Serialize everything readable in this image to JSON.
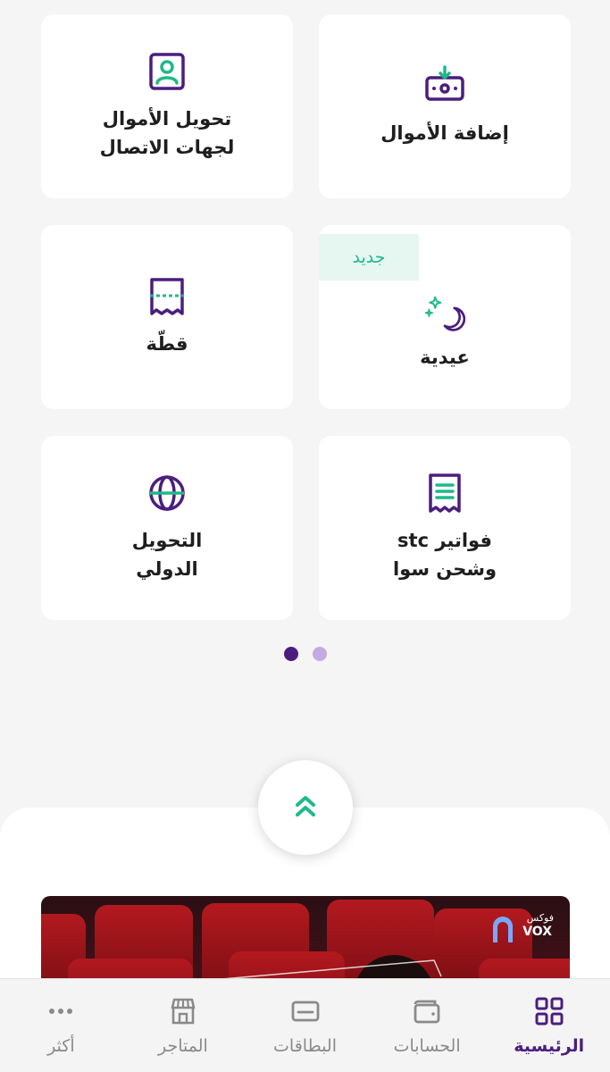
{
  "tiles": [
    {
      "label": "إضافة الأموال",
      "icon": "add-money-icon"
    },
    {
      "label": "تحويل الأموال\nلجهات الاتصال",
      "icon": "contact-transfer-icon"
    },
    {
      "label": "عيدية",
      "icon": "crescent-moon-icon",
      "badge": "جديد"
    },
    {
      "label": "قطّة",
      "icon": "split-bill-icon"
    },
    {
      "label": "فواتير stc\nوشحن سوا",
      "icon": "bill-receipt-icon"
    },
    {
      "label": "التحويل\nالدولي",
      "icon": "globe-icon"
    }
  ],
  "pager": {
    "total": 2,
    "active": 1
  },
  "banner": {
    "logo_ar": "فوكس",
    "logo_en": "VOX"
  },
  "nav": [
    {
      "label": "الرئيسية",
      "icon": "grid-home-icon",
      "active": true
    },
    {
      "label": "الحسابات",
      "icon": "wallet-icon",
      "active": false
    },
    {
      "label": "البطاقات",
      "icon": "card-icon",
      "active": false
    },
    {
      "label": "المتاجر",
      "icon": "store-icon",
      "active": false
    },
    {
      "label": "أكثر",
      "icon": "more-dots-icon",
      "active": false
    }
  ],
  "colors": {
    "primary": "#4b1e7e",
    "accent": "#1fb98a",
    "inactive": "#8a8a8a"
  }
}
